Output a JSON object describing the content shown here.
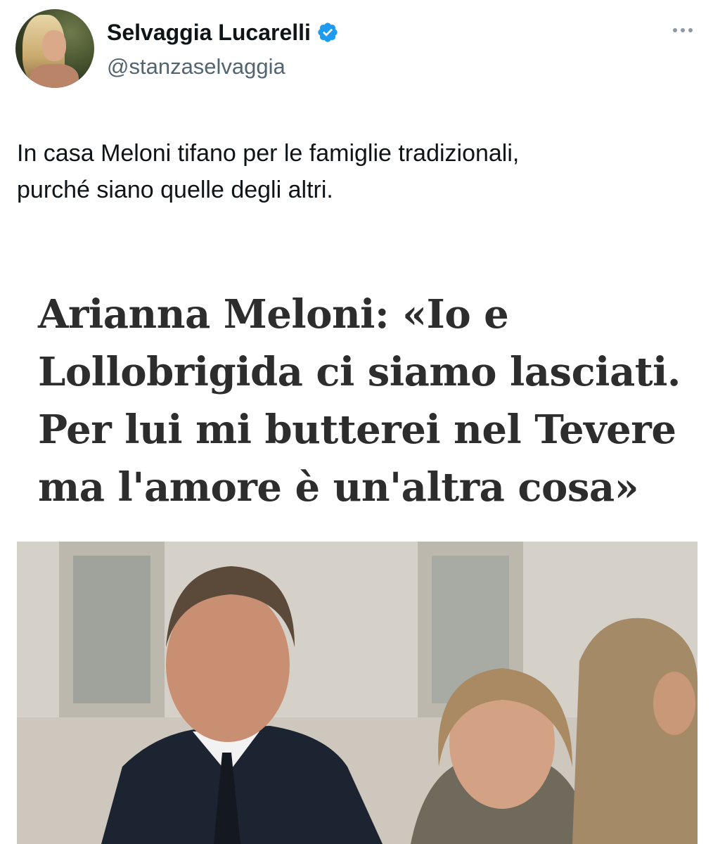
{
  "author": {
    "display_name": "Selvaggia Lucarelli",
    "handle": "@stanzaselvaggia",
    "verified": true,
    "verified_color": "#1d9bf0"
  },
  "tweet": {
    "text_lines": [
      "In casa Meloni tifano per le famiglie tradizionali,",
      "purché siano quelle degli altri."
    ]
  },
  "media": {
    "headline_lines": [
      "Arianna Meloni: «Io e",
      "Lollobrigida ci siamo lasciati.",
      "Per lui mi butterei nel Tevere",
      "ma l'amore è un'altra cosa»"
    ]
  },
  "icons": {
    "verified": "verified-badge-icon",
    "more": "more-options-icon"
  },
  "colors": {
    "text_primary": "#0f1419",
    "text_secondary": "#536471",
    "headline": "#2d2d2d"
  }
}
